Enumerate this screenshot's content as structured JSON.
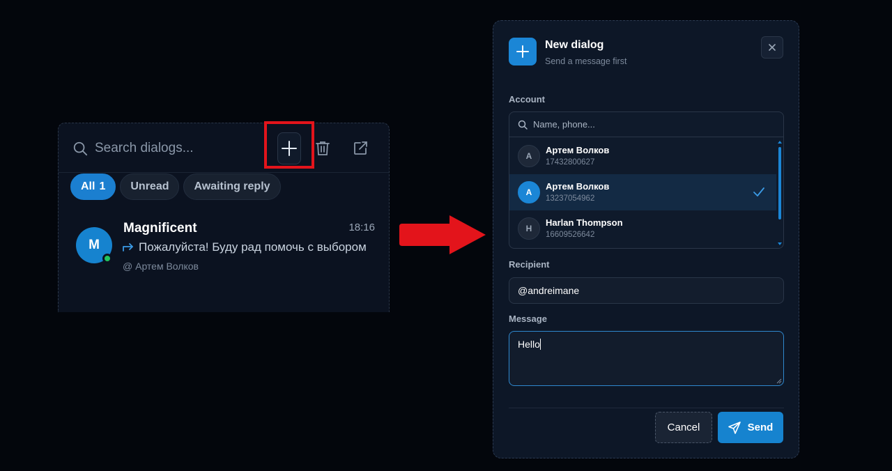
{
  "dialogs_panel": {
    "search": {
      "placeholder": "Search dialogs..."
    },
    "toolbar": {
      "new_dialog_icon": "plus-icon",
      "delete_icon": "trash-icon",
      "open_external_icon": "external-link-icon"
    },
    "filters": [
      {
        "label": "All",
        "count": "1",
        "active": true
      },
      {
        "label": "Unread",
        "active": false
      },
      {
        "label": "Awaiting reply",
        "active": false
      }
    ],
    "dialogs": [
      {
        "avatar_letter": "M",
        "name": "Magnificent",
        "time": "18:16",
        "preview": "Пожалуйста! Буду рад помочь с выбором",
        "account": "@ Артем Волков",
        "online": true
      }
    ]
  },
  "new_dialog_modal": {
    "title": "New dialog",
    "subtitle": "Send a message first",
    "account_label": "Account",
    "account_search_placeholder": "Name, phone...",
    "accounts": [
      {
        "letter": "A",
        "name": "Артем Волков",
        "phone": "17432800627",
        "selected": false
      },
      {
        "letter": "A",
        "name": "Артем Волков",
        "phone": "13237054962",
        "selected": true
      },
      {
        "letter": "H",
        "name": "Harlan Thompson",
        "phone": "16609526642",
        "selected": false
      }
    ],
    "recipient_label": "Recipient",
    "recipient_value": "@andreimane",
    "message_label": "Message",
    "message_value": "Hello",
    "cancel_label": "Cancel",
    "send_label": "Send"
  },
  "colors": {
    "accent": "#1683cf",
    "highlight": "#e3141b",
    "online": "#22c55e"
  }
}
